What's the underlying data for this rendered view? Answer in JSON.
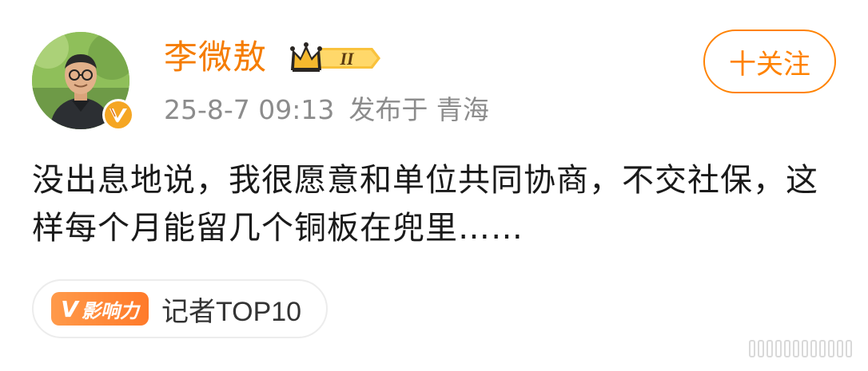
{
  "post": {
    "author": {
      "name": "李微敖",
      "level_badge": "II"
    },
    "meta": {
      "timestamp": "25-8-7 09:13",
      "location_prefix": "发布于",
      "location": "青海"
    },
    "follow_button": {
      "label": "十关注"
    },
    "content": {
      "text": "没出息地说，我很愿意和单位共同协商，不交社保，这样每个月能留几个铜板在兜里……"
    },
    "tag": {
      "badge_label": "影响力",
      "badge_prefix": "V",
      "text": "记者TOP10"
    }
  },
  "colors": {
    "name": "#f57c00",
    "accent": "#ff8200",
    "meta": "#8c8c8c",
    "text": "#1a1a1a",
    "badge_gold": "#f5a623"
  },
  "icons": [
    "avatar-photo",
    "verified-v-icon",
    "crown-icon",
    "influence-v-icon"
  ]
}
